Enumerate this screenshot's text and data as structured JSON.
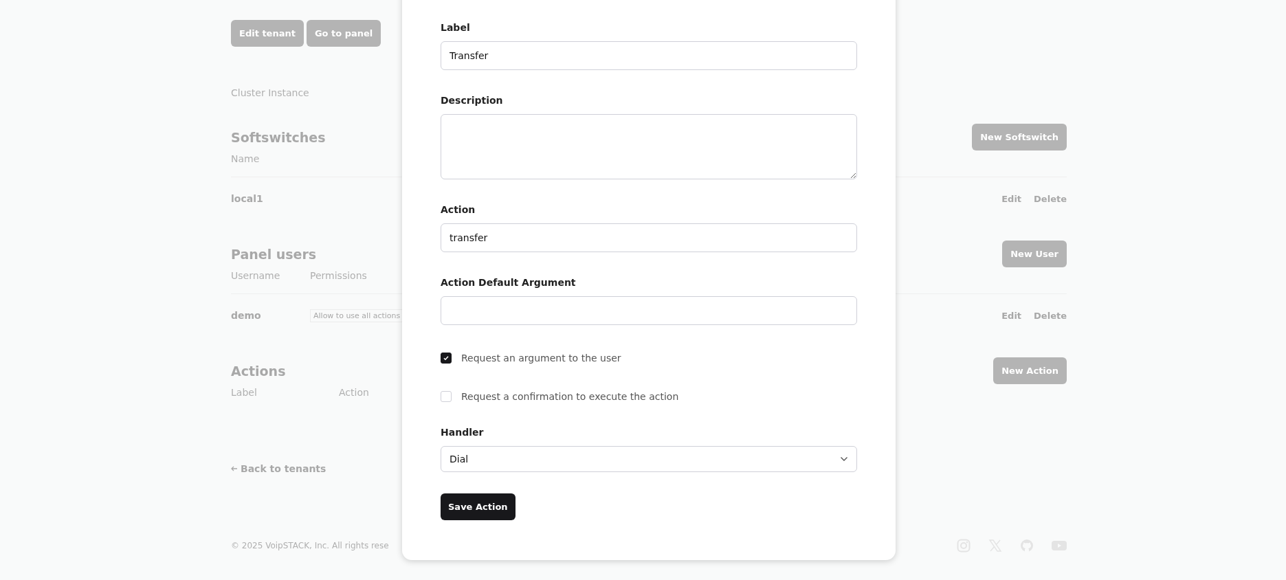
{
  "header_buttons": [
    "Edit tenant",
    "Go to panel"
  ],
  "cluster_label": "Cluster Instance",
  "sections": [
    {
      "title": "Softswitches",
      "button": "New Softswitch",
      "columns": [
        "Name"
      ],
      "rows": [
        {
          "cells": [
            "local1"
          ],
          "actions": [
            "Edit",
            "Delete"
          ]
        }
      ]
    },
    {
      "title": "Panel users",
      "button": "New User",
      "columns": [
        "Username",
        "Permissions"
      ],
      "rows": [
        {
          "cells": [
            "demo",
            "Allow to use all actions"
          ],
          "actions": [
            "Edit",
            "Delete"
          ]
        }
      ]
    },
    {
      "title": "Actions",
      "button": "New Action",
      "columns": [
        "Label",
        "Action"
      ]
    }
  ],
  "back_link": "Back to tenants",
  "footer": {
    "copyright": "© 2025 VoipSTACK, Inc. All rights rese"
  },
  "modal": {
    "fields": [
      {
        "kind": "text",
        "label": "Label",
        "value": "Transfer"
      },
      {
        "kind": "textarea",
        "label": "Description"
      },
      {
        "kind": "text",
        "label": "Action",
        "value": "transfer"
      },
      {
        "kind": "text",
        "label": "Action Default Argument"
      },
      {
        "kind": "checkbox",
        "label": "Request an argument to the user",
        "checked": true
      },
      {
        "kind": "checkbox",
        "label": "Request a confirmation to execute the action",
        "checked": false
      },
      {
        "kind": "select",
        "label": "Handler",
        "value": "Dial"
      }
    ],
    "submit": "Save Action"
  }
}
